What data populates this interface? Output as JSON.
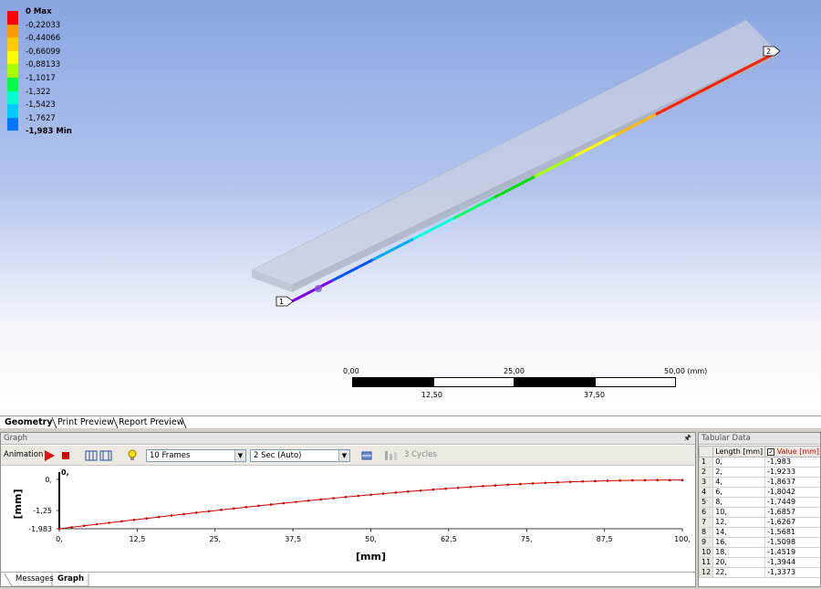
{
  "legend": {
    "items": [
      {
        "label": "0 Max",
        "color": "#ff0000",
        "bold": true
      },
      {
        "label": "-0,22033",
        "color": "#ff9900",
        "bold": false
      },
      {
        "label": "-0,44066",
        "color": "#ffcc00",
        "bold": false
      },
      {
        "label": "-0,66099",
        "color": "#ffff00",
        "bold": false
      },
      {
        "label": "-0,88133",
        "color": "#aaff00",
        "bold": false
      },
      {
        "label": "-1,1017",
        "color": "#00ff44",
        "bold": false
      },
      {
        "label": "-1,322",
        "color": "#00ffcc",
        "bold": false
      },
      {
        "label": "-1,5423",
        "color": "#00ccff",
        "bold": false
      },
      {
        "label": "-1,7627",
        "color": "#0077ff",
        "bold": false
      },
      {
        "label": "-1,983 Min",
        "color": "#0000ff",
        "bold": true
      }
    ]
  },
  "viewport": {
    "point1_label": "1",
    "point2_label": "2",
    "scale": {
      "top": [
        "0,00",
        "25,00",
        "50,00 (mm)"
      ],
      "bottom": [
        "12,50",
        "37,50"
      ]
    }
  },
  "tabs": {
    "geometry": "Geometry",
    "print_preview": "Print Preview",
    "report_preview": "Report Preview"
  },
  "graph_panel": {
    "title": "Graph",
    "animation_label": "Animation",
    "frames": "10 Frames",
    "duration": "2 Sec (Auto)",
    "cycles": "3 Cycles",
    "y_unit": "[mm]",
    "x_unit": "[mm]"
  },
  "chart_data": {
    "type": "line",
    "title": "",
    "xlabel": "[mm]",
    "ylabel": "[mm]",
    "xlim": [
      0,
      100
    ],
    "ylim": [
      -1.983,
      0
    ],
    "x_ticks": [
      "0,",
      "12,5",
      "25,",
      "37,5",
      "50,",
      "62,5",
      "75,",
      "87,5",
      "100,"
    ],
    "y_ticks": [
      "0,",
      "-1,25",
      "-1,983"
    ],
    "top_label": "0,",
    "series": [
      {
        "color": "#cc0000",
        "x": [
          0,
          2,
          4,
          6,
          8,
          10,
          12,
          14,
          16,
          18,
          20,
          22,
          24,
          26,
          28,
          30,
          32,
          34,
          36,
          38,
          40,
          42,
          44,
          46,
          48,
          50,
          52,
          54,
          56,
          58,
          60,
          62,
          64,
          66,
          68,
          70,
          72,
          74,
          76,
          78,
          80,
          82,
          84,
          86,
          88,
          90,
          92,
          94,
          96,
          98,
          100
        ],
        "values": [
          -1.983,
          -1.9233,
          -1.8637,
          -1.8042,
          -1.7449,
          -1.6857,
          -1.6267,
          -1.5681,
          -1.5098,
          -1.4519,
          -1.3944,
          -1.3373,
          -1.2808,
          -1.2249,
          -1.1696,
          -1.1149,
          -1.061,
          -1.0078,
          -0.9554,
          -0.9039,
          -0.8533,
          -0.8037,
          -0.7551,
          -0.7076,
          -0.6612,
          -0.616,
          -0.5721,
          -0.5294,
          -0.4881,
          -0.4482,
          -0.4097,
          -0.3728,
          -0.3374,
          -0.3037,
          -0.2716,
          -0.2413,
          -0.2127,
          -0.186,
          -0.1612,
          -0.1383,
          -0.1174,
          -0.0986,
          -0.0818,
          -0.0671,
          -0.0546,
          -0.0443,
          -0.0362,
          -0.0304,
          -0.0268,
          -0.0257,
          -0.025
        ]
      }
    ]
  },
  "tabular": {
    "title": "Tabular Data",
    "col_length": "Length [mm]",
    "col_value": "Value [mm]",
    "rows": [
      [
        "1",
        "0,",
        "-1,983"
      ],
      [
        "2",
        "2,",
        "-1,9233"
      ],
      [
        "3",
        "4,",
        "-1,8637"
      ],
      [
        "4",
        "6,",
        "-1,8042"
      ],
      [
        "5",
        "8,",
        "-1,7449"
      ],
      [
        "6",
        "10,",
        "-1,6857"
      ],
      [
        "7",
        "12,",
        "-1,6267"
      ],
      [
        "8",
        "14,",
        "-1,5681"
      ],
      [
        "9",
        "16,",
        "-1,5098"
      ],
      [
        "10",
        "18,",
        "-1,4519"
      ],
      [
        "11",
        "20,",
        "-1,3944"
      ],
      [
        "12",
        "22,",
        "-1,3373"
      ]
    ]
  },
  "bottom_tabs": {
    "messages": "Messages",
    "graph": "Graph"
  }
}
